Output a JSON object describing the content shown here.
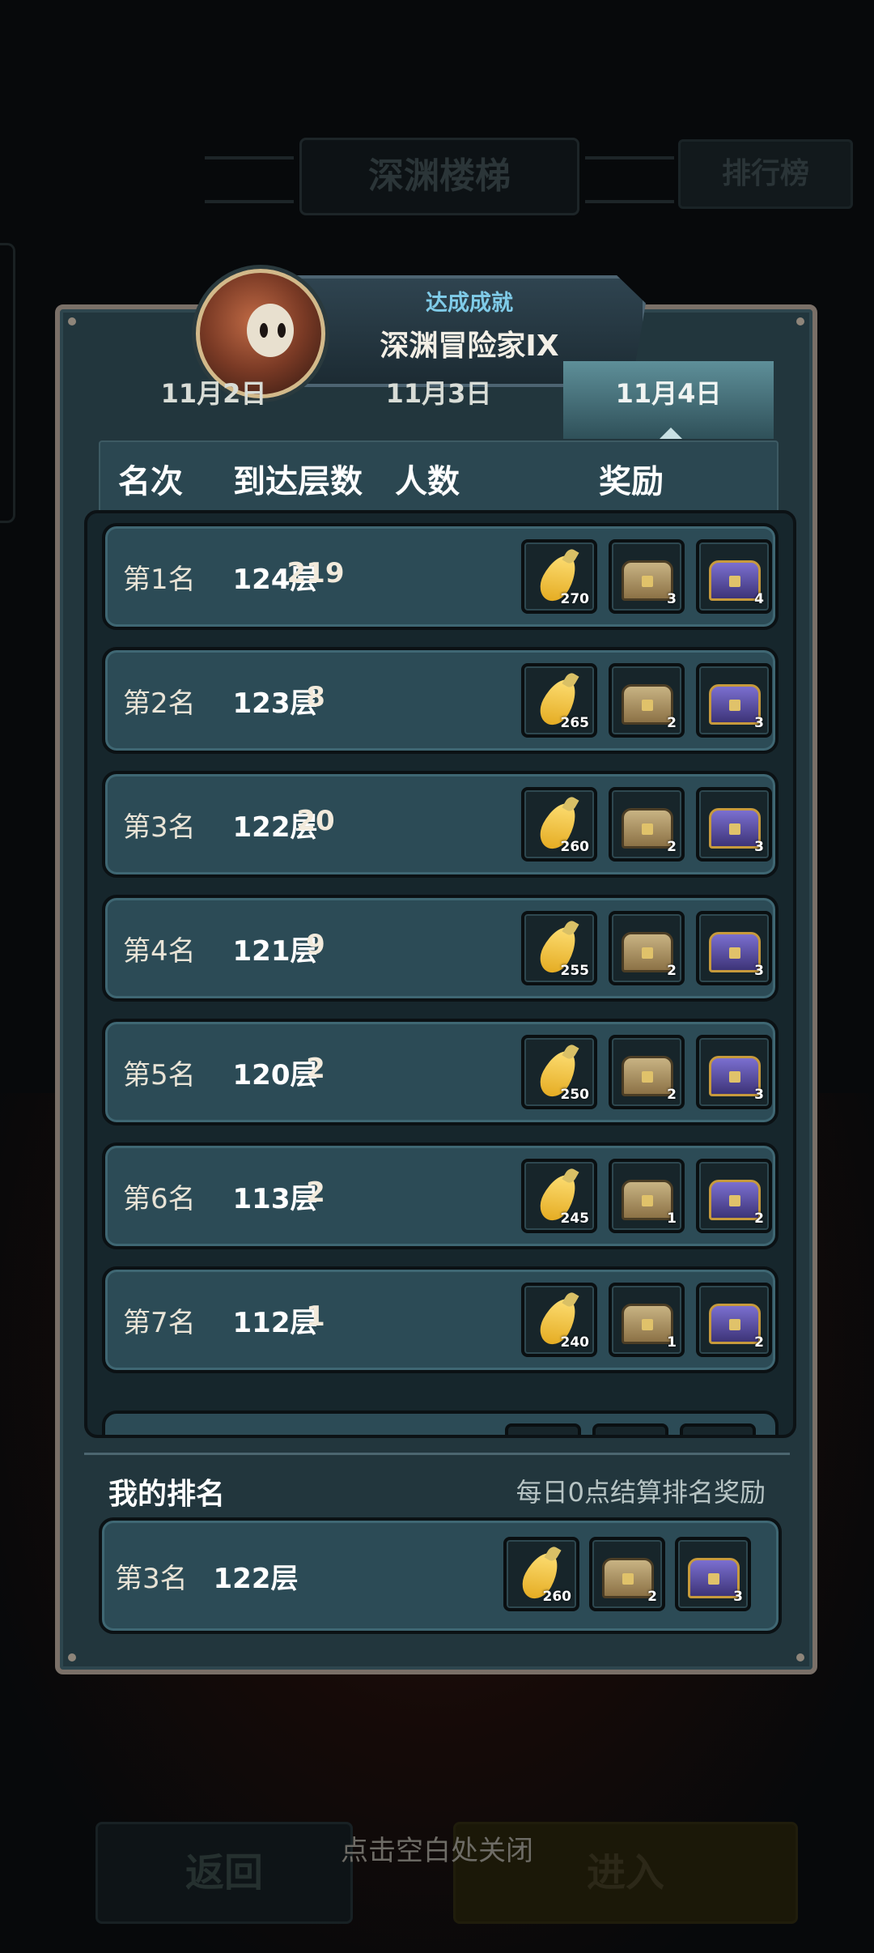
{
  "background": {
    "title": "深渊楼梯",
    "rank_button": "排行榜",
    "back_button": "返回",
    "enter_button": "进入",
    "close_hint": "点击空白处关闭"
  },
  "achievement": {
    "subtitle": "达成成就",
    "title": "深渊冒险家IX"
  },
  "tabs": [
    {
      "label": "11月2日",
      "active": false
    },
    {
      "label": "11月3日",
      "active": false
    },
    {
      "label": "11月4日",
      "active": true
    }
  ],
  "header": {
    "rank": "名次",
    "floor": "到达层数",
    "count": "人数",
    "reward": "奖励"
  },
  "rows": [
    {
      "rank": "第1名",
      "floor": "124层",
      "count": "219",
      "carrot": "270",
      "chest_gold": "3",
      "chest_purple": "4"
    },
    {
      "rank": "第2名",
      "floor": "123层",
      "count": "8",
      "carrot": "265",
      "chest_gold": "2",
      "chest_purple": "3"
    },
    {
      "rank": "第3名",
      "floor": "122层",
      "count": "20",
      "carrot": "260",
      "chest_gold": "2",
      "chest_purple": "3"
    },
    {
      "rank": "第4名",
      "floor": "121层",
      "count": "9",
      "carrot": "255",
      "chest_gold": "2",
      "chest_purple": "3"
    },
    {
      "rank": "第5名",
      "floor": "120层",
      "count": "2",
      "carrot": "250",
      "chest_gold": "2",
      "chest_purple": "3"
    },
    {
      "rank": "第6名",
      "floor": "113层",
      "count": "2",
      "carrot": "245",
      "chest_gold": "1",
      "chest_purple": "2"
    },
    {
      "rank": "第7名",
      "floor": "112层",
      "count": "1",
      "carrot": "240",
      "chest_gold": "1",
      "chest_purple": "2"
    }
  ],
  "my_ranking": {
    "title": "我的排名",
    "note": "每日0点结算排名奖励",
    "rank": "第3名",
    "floor": "122层",
    "carrot": "260",
    "chest_gold": "2",
    "chest_purple": "3"
  }
}
